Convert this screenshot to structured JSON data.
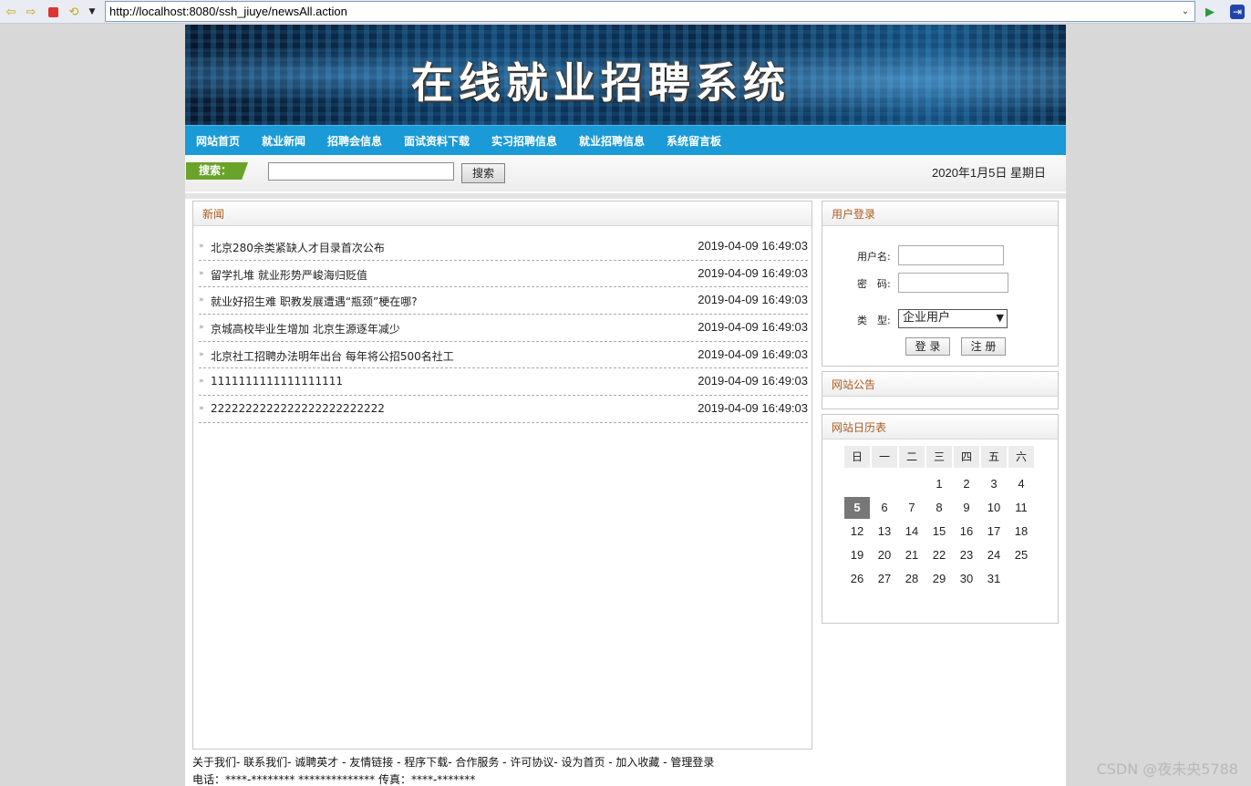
{
  "browser": {
    "url": "http://localhost:8080/ssh_jiuye/newsAll.action",
    "icons": [
      "back-arrow-icon",
      "forward-arrow-icon",
      "stop-icon",
      "refresh-icon",
      "go-icon",
      "exit-icon"
    ]
  },
  "header": {
    "title": "在线就业招聘系统",
    "nav": [
      "网站首页",
      "就业新闻",
      "招聘会信息",
      "面试资料下载",
      "实习招聘信息",
      "就业招聘信息",
      "系统留言板"
    ]
  },
  "search": {
    "tag": "搜索：",
    "button": "搜索",
    "date": "2020年1月5日 星期日"
  },
  "news": {
    "heading": "新闻",
    "items": [
      {
        "title": "北京280余类紧缺人才目录首次公布",
        "time": "2019-04-09 16:49:03"
      },
      {
        "title": "留学扎堆 就业形势严峻海归贬值",
        "time": "2019-04-09 16:49:03"
      },
      {
        "title": "就业好招生难 职教发展遭遇“瓶颈”梗在哪?",
        "time": "2019-04-09 16:49:03"
      },
      {
        "title": "京城高校毕业生增加 北京生源逐年减少",
        "time": "2019-04-09 16:49:03"
      },
      {
        "title": "北京社工招聘办法明年出台 每年将公招500名社工",
        "time": "2019-04-09 16:49:03"
      },
      {
        "title": "1111111111111111111",
        "time": "2019-04-09 16:49:03"
      },
      {
        "title": "2222222222222222222222222",
        "time": "2019-04-09 16:49:03"
      }
    ]
  },
  "login": {
    "heading": "用户登录",
    "username_label": "用户名:",
    "password_label": "密　码:",
    "type_label": "类　型:",
    "type_value": "企业用户",
    "login_button": "登 录",
    "register_button": "注 册"
  },
  "notice": {
    "heading": "网站公告"
  },
  "calendar": {
    "heading": "网站日历表",
    "weekdays": [
      "日",
      "一",
      "二",
      "三",
      "四",
      "五",
      "六"
    ],
    "first_weekday": 3,
    "days": 31,
    "today": 5
  },
  "footer": {
    "links": "关于我们- 联系我们- 诚聘英才 - 友情链接 - 程序下载- 合作服务 - 许可协议- 设为首页 - 加入收藏 - 管理登录",
    "contact": "电话：****-******** ************** 传真：****-*******"
  },
  "watermark": "CSDN @夜未央5788"
}
